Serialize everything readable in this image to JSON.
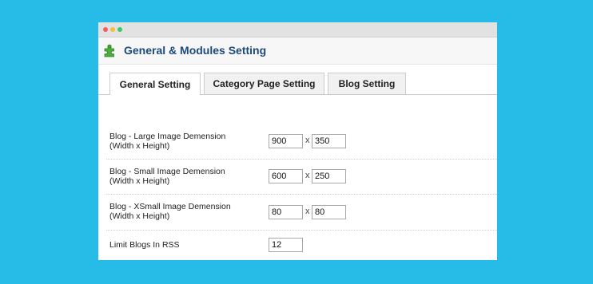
{
  "header": {
    "title": "General & Modules Setting"
  },
  "tabs": [
    {
      "label": "General Setting",
      "active": true
    },
    {
      "label": "Category Page Setting",
      "active": false
    },
    {
      "label": "Blog Setting",
      "active": false
    }
  ],
  "rows": [
    {
      "label": "Blog - Large Image Demension",
      "sublabel": "(Width x Height)",
      "width": "900",
      "height": "350",
      "sep": "x"
    },
    {
      "label": "Blog - Small Image Demension",
      "sublabel": "(Width x Height)",
      "width": "600",
      "height": "250",
      "sep": "x"
    },
    {
      "label": "Blog - XSmall Image Demension",
      "sublabel": "(Width x Height)",
      "width": "80",
      "height": "80",
      "sep": "x"
    },
    {
      "label": "Limit Blogs In RSS",
      "value": "12"
    }
  ],
  "colors": {
    "background": "#27bbe8",
    "title": "#1c4a7c",
    "icon": "#4cae3a"
  }
}
